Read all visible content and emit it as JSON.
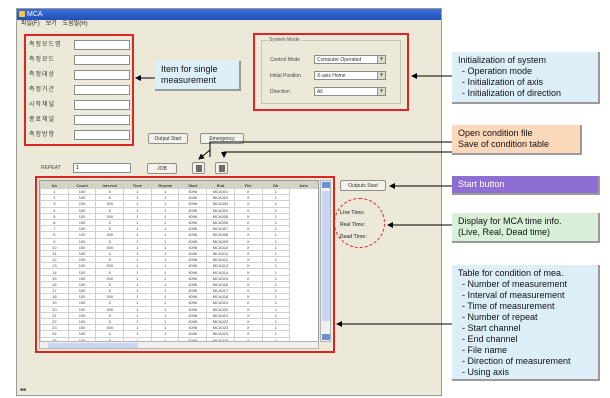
{
  "window": {
    "title": "MCA",
    "menu": [
      "파일(F)",
      "보기",
      "도움말(H)"
    ]
  },
  "fields": [
    "측정모드명",
    "측정모드",
    "측정대상",
    "측정기간",
    "시작채널",
    "종료채널",
    "측정방향"
  ],
  "system": {
    "group_title": "System Mode",
    "rows": [
      {
        "label": "Control Mode",
        "value": "Computer Operated"
      },
      {
        "label": "Initial Position",
        "value": "X-axis Home"
      },
      {
        "label": "Direction",
        "value": "All"
      }
    ]
  },
  "buttons": {
    "output_start": "Output Start",
    "emergency": "Emergency",
    "outputs_start": "Outputs Start",
    "job": "JOB",
    "repeat_label": "REPEAT",
    "repeat_value": "1"
  },
  "time": [
    "Live Time:",
    "Real Time:",
    "Dead Time:"
  ],
  "table": {
    "headers": [
      "No",
      "Count",
      "Interval",
      "Time",
      "Repeat",
      "Start",
      "End",
      "File",
      "Dir",
      "Axis"
    ],
    "rows": [
      [
        "1",
        "100",
        "5",
        "1",
        "1",
        "4096",
        "MCA001",
        "X",
        "1"
      ],
      [
        "2",
        "100",
        "5",
        "1",
        "1",
        "4096",
        "MCA002",
        "X",
        "1"
      ],
      [
        "3",
        "100",
        "300",
        "1",
        "1",
        "4096",
        "MCA003",
        "X",
        "1"
      ],
      [
        "4",
        "100",
        "5",
        "1",
        "1",
        "4096",
        "MCA004",
        "X",
        "1"
      ],
      [
        "5",
        "100",
        "300",
        "1",
        "1",
        "4096",
        "MCA005",
        "X",
        "1"
      ],
      [
        "6",
        "100",
        "5",
        "1",
        "1",
        "4096",
        "MCA006",
        "X",
        "1"
      ],
      [
        "7",
        "100",
        "5",
        "1",
        "1",
        "4096",
        "MCA007",
        "X",
        "1"
      ],
      [
        "8",
        "100",
        "300",
        "1",
        "1",
        "4096",
        "MCA008",
        "X",
        "1"
      ],
      [
        "9",
        "100",
        "5",
        "1",
        "1",
        "4096",
        "MCA009",
        "X",
        "1"
      ],
      [
        "10",
        "100",
        "300",
        "1",
        "1",
        "4096",
        "MCA010",
        "X",
        "1"
      ],
      [
        "11",
        "100",
        "5",
        "1",
        "1",
        "4096",
        "MCA011",
        "X",
        "1"
      ],
      [
        "12",
        "100",
        "5",
        "1",
        "1",
        "4096",
        "MCA012",
        "X",
        "1"
      ],
      [
        "13",
        "100",
        "300",
        "1",
        "1",
        "4096",
        "MCA013",
        "X",
        "1"
      ],
      [
        "14",
        "100",
        "5",
        "1",
        "1",
        "4096",
        "MCA014",
        "X",
        "1"
      ],
      [
        "15",
        "100",
        "300",
        "1",
        "1",
        "4096",
        "MCA015",
        "X",
        "1"
      ],
      [
        "16",
        "100",
        "5",
        "1",
        "1",
        "4096",
        "MCA016",
        "X",
        "1"
      ],
      [
        "17",
        "100",
        "5",
        "1",
        "1",
        "4096",
        "MCA017",
        "X",
        "1"
      ],
      [
        "18",
        "100",
        "300",
        "1",
        "1",
        "4096",
        "MCA018",
        "X",
        "1"
      ],
      [
        "19",
        "100",
        "5",
        "1",
        "1",
        "4096",
        "MCA019",
        "X",
        "1"
      ],
      [
        "20",
        "100",
        "300",
        "1",
        "1",
        "4096",
        "MCA020",
        "X",
        "1"
      ],
      [
        "21",
        "100",
        "5",
        "1",
        "1",
        "4096",
        "MCA021",
        "X",
        "1"
      ],
      [
        "22",
        "100",
        "5",
        "1",
        "1",
        "4096",
        "MCA022",
        "X",
        "1"
      ],
      [
        "23",
        "100",
        "300",
        "1",
        "1",
        "4096",
        "MCA023",
        "X",
        "1"
      ],
      [
        "24",
        "100",
        "5",
        "1",
        "1",
        "4096",
        "MCA024",
        "X",
        "1"
      ],
      [
        "25",
        "100",
        "5",
        "1",
        "1",
        "4096",
        "MCA025",
        "X",
        "1"
      ]
    ]
  },
  "callouts": {
    "single": "Item for single measurement",
    "init": {
      "title": "Initialization of system",
      "items": [
        "- Operation mode",
        "- Initialization of axis",
        "- Initialization of direction"
      ]
    },
    "condition": [
      "Open condition file",
      "Save of condition table"
    ],
    "start": "Start button",
    "time": [
      "Display for MCA time info.",
      "(Live, Real, Dead time)"
    ],
    "table": {
      "title": "Table for condition of mea.",
      "items": [
        "- Number of measurement",
        "- Interval of measurement",
        "- Time of measurement",
        "- Number of repeat",
        "- Start channel",
        "- End channel",
        "- File name",
        "- Direction of measurement",
        "- Using axis"
      ]
    }
  },
  "colors": {
    "highlight": "#e02424",
    "blue": "#dceef7",
    "orange": "#fcd8bb",
    "purple": "#8f6ed3",
    "green": "#d8f0d8"
  }
}
